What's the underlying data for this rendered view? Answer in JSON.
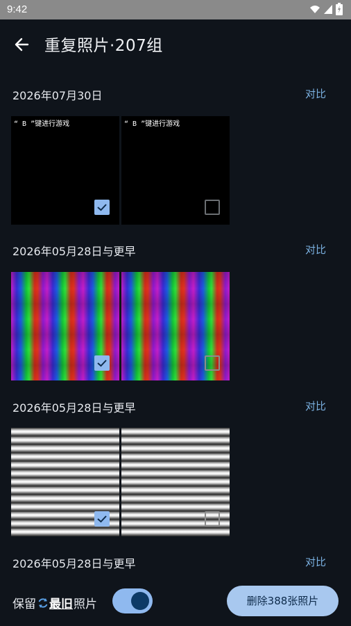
{
  "status_bar": {
    "time": "9:42"
  },
  "header": {
    "title": "重复照片·207组"
  },
  "groups": [
    {
      "date": "2026年07月30日",
      "compare_label": "对比",
      "caption": "“ B ”键进行游戏"
    },
    {
      "date": "2026年05月28日与更早",
      "compare_label": "对比"
    },
    {
      "date": "2026年05月28日与更早",
      "compare_label": "对比"
    },
    {
      "date": "2026年05月28日与更早",
      "compare_label": "对比"
    }
  ],
  "bottom_bar": {
    "keep_prefix": "保留",
    "keep_option": "最旧",
    "keep_suffix": "照片",
    "toggle_on": true,
    "delete_label": "删除388张照片"
  },
  "colors": {
    "accent": "#8fb9ef",
    "link": "#7ab0e0",
    "background": "#0f141b"
  }
}
